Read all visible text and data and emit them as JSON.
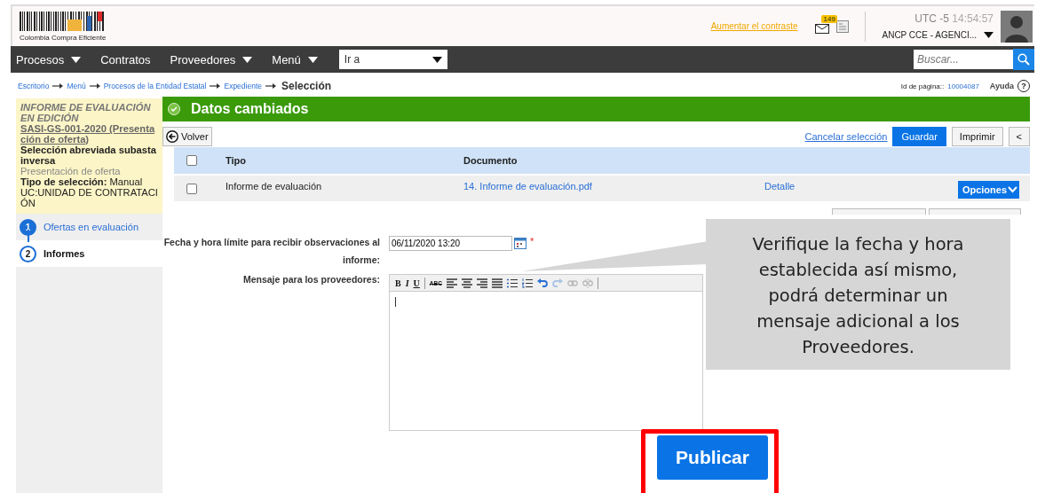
{
  "header": {
    "logo_text": "Colombia Compra Eficiente",
    "contrast_link": "Aumentar el contraste",
    "mail_badge": "149",
    "timezone": "UTC -5",
    "time": "14:54:57",
    "account": "ANCP CCE - AGENCI..."
  },
  "nav": {
    "items": [
      {
        "label": "Procesos",
        "dropdown": true
      },
      {
        "label": "Contratos",
        "dropdown": false
      },
      {
        "label": "Proveedores",
        "dropdown": true
      },
      {
        "label": "Menú",
        "dropdown": true
      }
    ],
    "goto_select": {
      "value": "Ir a"
    },
    "search": {
      "placeholder": "Buscar..."
    }
  },
  "breadcrumb": {
    "links": [
      "Escritorio",
      "Menú",
      "Procesos de la Entidad Estatal",
      "Expediente"
    ],
    "current": "Selección"
  },
  "page_id": {
    "label": "Id de página::",
    "value": "10004087"
  },
  "help": "Ayuda",
  "help_icon": "?",
  "sidebar": {
    "info": [
      {
        "kind": "status",
        "text": "INFORME DE EVALUACIÓN EN EDICIÓN"
      },
      {
        "kind": "link",
        "text": "SASI-GS-001-2020 (Presentación de oferta)"
      },
      {
        "kind": "title",
        "text": "Selección abreviada subasta inversa"
      },
      {
        "kind": "phase",
        "text": "Presentación de oferta"
      },
      {
        "kind": "detail",
        "text": "**Tipo de selección:** Manual"
      },
      {
        "kind": "detail",
        "text": "UC:UNIDAD DE CONTRATACIÓN"
      }
    ],
    "steps": [
      {
        "number": "1",
        "label": "Ofertas en evaluación",
        "selected": false
      },
      {
        "number": "2",
        "label": "Informes",
        "selected": true
      }
    ]
  },
  "banner": {
    "text": "Datos cambiados"
  },
  "toolbar": {
    "back": "Volver",
    "cancel": "Cancelar selección",
    "save": "Guardar",
    "print": "Imprimir",
    "collapse": "<"
  },
  "table": {
    "columns": [
      "Tipo",
      "Documento"
    ],
    "header_checked": false,
    "rows": [
      {
        "checked": false,
        "tipo": "Informe de evaluación",
        "documento": "14. Informe de evaluación.pdf",
        "detail": "Detalle",
        "options": "Opciones"
      }
    ]
  },
  "form": {
    "deadline": {
      "label": "Fecha y hora límite para recibir observaciones al informe:",
      "value": "06/11/2020 13:20",
      "required_mark": "*"
    },
    "message": {
      "label": "Mensaje para los proveedores:",
      "toolbar": [
        {
          "kind": "text",
          "label": "B",
          "disabled": false
        },
        {
          "kind": "italic",
          "label": "I",
          "disabled": false
        },
        {
          "kind": "underline",
          "label": "U",
          "disabled": false
        },
        {
          "kind": "spellcheck",
          "label": "ABC",
          "disabled": false
        },
        {
          "kind": "align-left",
          "disabled": false
        },
        {
          "kind": "align-center",
          "disabled": false
        },
        {
          "kind": "align-right",
          "disabled": false
        },
        {
          "kind": "justify",
          "disabled": false
        },
        {
          "kind": "bullets",
          "disabled": false
        },
        {
          "kind": "numbers",
          "disabled": false
        },
        {
          "kind": "undo",
          "disabled": false
        },
        {
          "kind": "redo",
          "disabled": true
        },
        {
          "kind": "link",
          "disabled": true
        },
        {
          "kind": "unlink",
          "disabled": true
        }
      ]
    }
  },
  "callout": {
    "text": "Verifique la fecha y hora establecida así mismo, podrá determinar un mensaje adicional a los Proveedores."
  },
  "publish_button": "Publicar"
}
